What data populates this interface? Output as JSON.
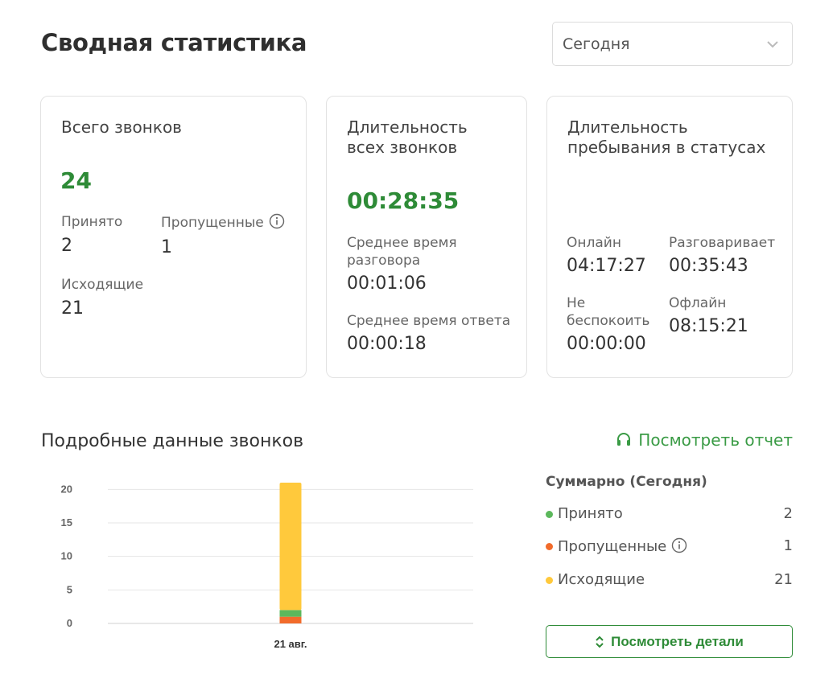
{
  "page": {
    "title": "Сводная статистика"
  },
  "period": {
    "selected": "Сегодня"
  },
  "cards": {
    "calls": {
      "title": "Всего звонков",
      "total": "24",
      "accepted_label": "Принято",
      "accepted_value": "2",
      "missed_label": "Пропущенные",
      "missed_value": "1",
      "outgoing_label": "Исходящие",
      "outgoing_value": "21"
    },
    "duration": {
      "title_line1": "Длительность",
      "title_line2": "всех звонков",
      "total": "00:28:35",
      "avg_talk_label_line1": "Среднее время",
      "avg_talk_label_line2": "разговора",
      "avg_talk_value": "00:01:06",
      "avg_answer_label": "Среднее время ответа",
      "avg_answer_value": "00:00:18"
    },
    "statuses": {
      "title_line1": "Длительность",
      "title_line2": "пребывания в статусах",
      "online_label": "Онлайн",
      "online_value": "04:17:27",
      "talking_label": "Разговаривает",
      "talking_value": "00:35:43",
      "dnd_label_line1": "Не",
      "dnd_label_line2": "беспокоить",
      "dnd_value": "00:00:00",
      "offline_label": "Офлайн",
      "offline_value": "08:15:21"
    }
  },
  "details": {
    "title": "Подробные данные звонков",
    "report_link": "Посмотреть отчет",
    "summary_title": "Суммарно (Сегодня)",
    "summary": [
      {
        "name": "Принято",
        "count": "2",
        "color": "#5cb85c"
      },
      {
        "name": "Пропущенные",
        "count": "1",
        "color": "#f26b2b"
      },
      {
        "name": "Исходящие",
        "count": "21",
        "color": "#ffc93c"
      }
    ],
    "details_button": "Посмотреть детали"
  },
  "chart_data": {
    "type": "bar",
    "stacked": true,
    "categories": [
      "21 авг."
    ],
    "series": [
      {
        "name": "Пропущенные",
        "values": [
          1
        ],
        "color": "#f26b2b"
      },
      {
        "name": "Принято",
        "values": [
          1
        ],
        "color": "#5cb85c"
      },
      {
        "name": "Исходящие",
        "values": [
          19
        ],
        "color": "#ffc93c"
      }
    ],
    "yticks": [
      0,
      5,
      10,
      15,
      20
    ],
    "ylim": [
      0,
      21
    ],
    "grid": true,
    "legend": "none"
  }
}
